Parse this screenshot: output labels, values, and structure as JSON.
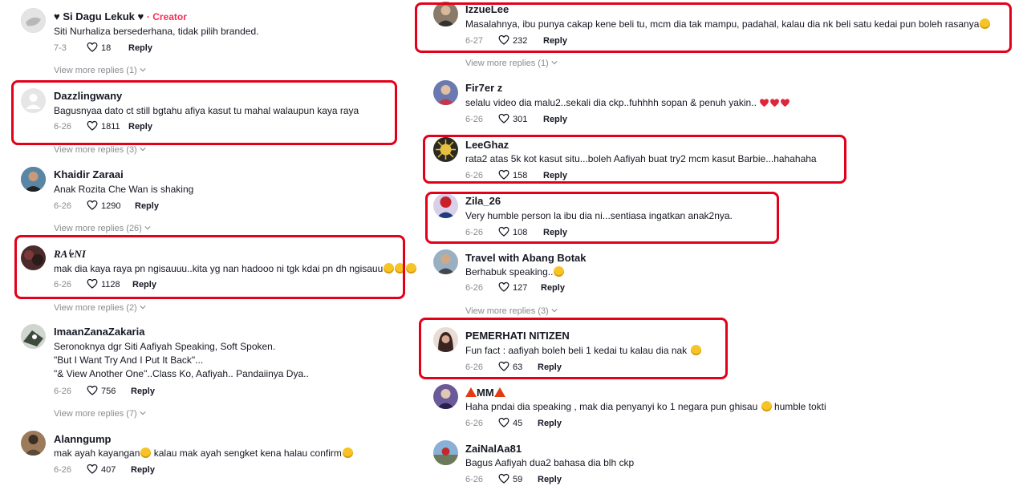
{
  "comments_left": [
    {
      "name": "♥ Si Dagu Lekuk ♥",
      "badge": "· Creator",
      "text": "Siti Nurhaliza bersederhana, tidak pilih branded.",
      "date": "7-3",
      "likes": "18",
      "reply": "Reply",
      "more": "View more replies (1)"
    },
    {
      "name": "Dazzlingwany",
      "text": "Bagusnyaa dato ct still bgtahu afiya kasut tu mahal walaupun kaya raya",
      "date": "6-26",
      "likes": "1811",
      "reply": "Reply",
      "more": "View more replies (3)"
    },
    {
      "name": "Khaidir Zaraai",
      "text": "Anak Rozita Che Wan is shaking",
      "date": "6-26",
      "likes": "1290",
      "reply": "Reply",
      "more": "View more replies (26)"
    },
    {
      "name": "RAⁱeNI",
      "text": "mak dia kaya raya pn ngisauuu..kita yg nan hadooo ni tgk kdai pn dh ngisauu",
      "date": "6-26",
      "likes": "1128",
      "reply": "Reply",
      "more": "View more replies (2)"
    },
    {
      "name": "ImaanZanaZakaria",
      "text": "Seronoknya dgr Siti Aafiyah Speaking, Soft Spoken.",
      "text2": "\"But I Want Try And I Put It Back\"...",
      "text3": "\"& View Another One\"..Class Ko, Aafiyah.. Pandaiinya Dya..",
      "date": "6-26",
      "likes": "756",
      "reply": "Reply",
      "more": "View more replies (7)"
    },
    {
      "name": "Alanngump",
      "text": "mak ayah kayangan",
      "text_b": "kalau mak ayah sengket kena halau confirm",
      "date": "6-26",
      "likes": "407",
      "reply": "Reply"
    }
  ],
  "comments_right": [
    {
      "name": "IzzueLee",
      "text": "Masalahnya, ibu punya cakap kene beli tu, mcm dia tak mampu, padahal, kalau dia nk beli satu kedai pun boleh rasanya",
      "date": "6-27",
      "likes": "232",
      "reply": "Reply",
      "more": "View more replies (1)"
    },
    {
      "name": "Fir7er z",
      "text": "selalu video dia malu2..sekali dia ckp..fuhhhh sopan & penuh yakin..",
      "date": "6-26",
      "likes": "301",
      "reply": "Reply"
    },
    {
      "name": "LeeGhaz",
      "text": "rata2 atas 5k kot kasut situ...boleh Aafiyah buat try2 mcm kasut Barbie...hahahaha",
      "date": "6-26",
      "likes": "158",
      "reply": "Reply"
    },
    {
      "name": "Zila_26",
      "text": "Very humble person la ibu dia ni...sentiasa ingatkan anak2nya.",
      "date": "6-26",
      "likes": "108",
      "reply": "Reply"
    },
    {
      "name": "Travel with Abang Botak",
      "text": "Berhabuk speaking..",
      "date": "6-26",
      "likes": "127",
      "reply": "Reply",
      "more": "View more replies (3)"
    },
    {
      "name": "PEMERHATI NITIZEN",
      "text": "Fun fact : aafiyah boleh beli 1 kedai tu kalau dia nak",
      "date": "6-26",
      "likes": "63",
      "reply": "Reply"
    },
    {
      "name": "MM",
      "text": "Haha pndai dia speaking , mak dia penyanyi ko 1 negara pun ghisau",
      "text_b": "humble tokti",
      "date": "6-26",
      "likes": "45",
      "reply": "Reply"
    },
    {
      "name": "ZaiNalAa81",
      "text": "Bagus Aafiyah dua2 bahasa dia blh ckp",
      "date": "6-26",
      "likes": "59",
      "reply": "Reply"
    }
  ],
  "icons": {
    "like": "heart-outline-icon",
    "chevron": "chevron-down-icon",
    "emoji": "laughing-emoji"
  },
  "colors": {
    "highlight": "#e3001b",
    "creator": "#fe2c55",
    "meta": "#8a8b91"
  }
}
